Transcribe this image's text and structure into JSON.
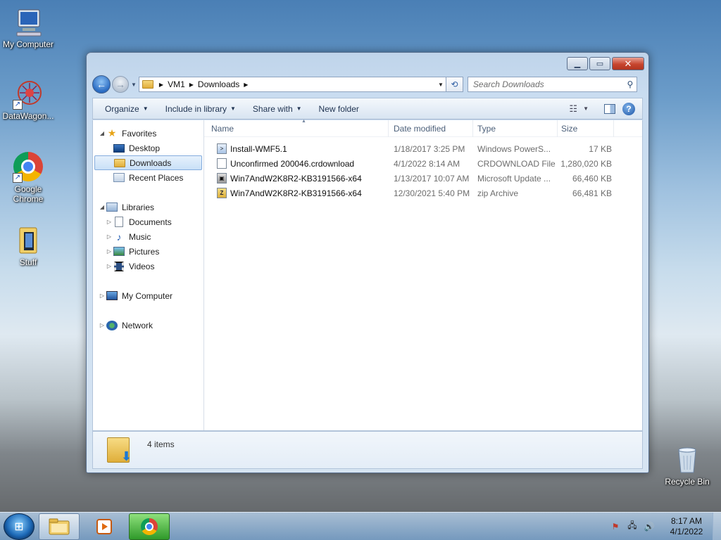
{
  "desktop": {
    "icons": [
      {
        "label": "My Computer",
        "icon": "computer-icon"
      },
      {
        "label": "DataWagon...",
        "icon": "datawagon-icon"
      },
      {
        "label": "Google Chrome",
        "icon": "chrome-icon"
      },
      {
        "label": "Stuff",
        "icon": "folder-icon"
      },
      {
        "label": "Recycle Bin",
        "icon": "recycle-bin-icon"
      }
    ]
  },
  "window": {
    "breadcrumb": [
      "VM1",
      "Downloads"
    ],
    "search_placeholder": "Search Downloads",
    "toolbar": {
      "organize": "Organize",
      "include_in_library": "Include in library",
      "share_with": "Share with",
      "new_folder": "New folder"
    },
    "nav": {
      "favorites": "Favorites",
      "desktop": "Desktop",
      "downloads": "Downloads",
      "recent_places": "Recent Places",
      "libraries": "Libraries",
      "documents": "Documents",
      "music": "Music",
      "pictures": "Pictures",
      "videos": "Videos",
      "my_computer": "My Computer",
      "network": "Network"
    },
    "columns": {
      "name": "Name",
      "date": "Date modified",
      "type": "Type",
      "size": "Size"
    },
    "files": [
      {
        "name": "Install-WMF5.1",
        "date": "1/18/2017 3:25 PM",
        "type": "Windows PowerS...",
        "size": "17 KB",
        "icon": "powershell-script-icon"
      },
      {
        "name": "Unconfirmed 200046.crdownload",
        "date": "4/1/2022 8:14 AM",
        "type": "CRDOWNLOAD File",
        "size": "1,280,020 KB",
        "icon": "blank-file-icon"
      },
      {
        "name": "Win7AndW2K8R2-KB3191566-x64",
        "date": "1/13/2017 10:07 AM",
        "type": "Microsoft Update ...",
        "size": "66,460 KB",
        "icon": "update-package-icon"
      },
      {
        "name": "Win7AndW2K8R2-KB3191566-x64",
        "date": "12/30/2021 5:40 PM",
        "type": "zip Archive",
        "size": "66,481 KB",
        "icon": "zip-archive-icon"
      }
    ],
    "details": {
      "count": "4 items"
    }
  },
  "taskbar": {
    "time": "8:17 AM",
    "date": "4/1/2022"
  }
}
